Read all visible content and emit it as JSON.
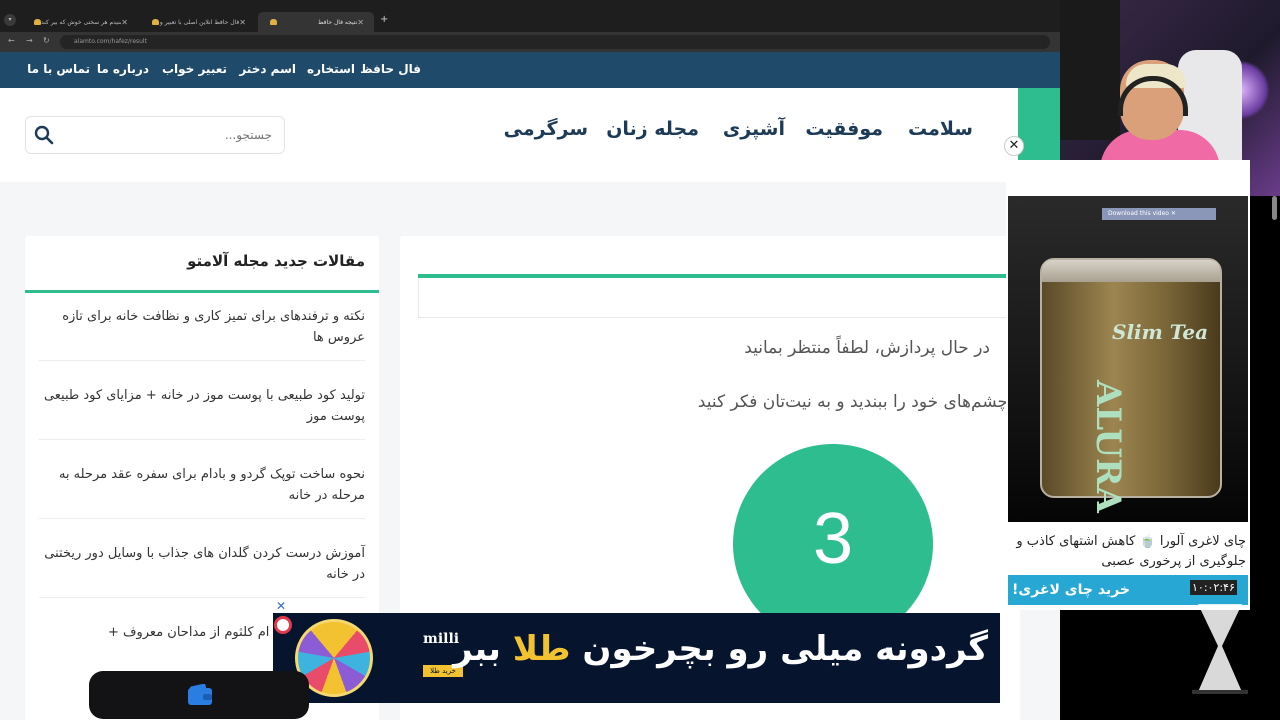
{
  "browser": {
    "tabs": [
      {
        "title": "شنیدم هر سختی خوش که بیر کند"
      },
      {
        "title": "فال حافظ آنلاین اصلی با تعبیر و"
      },
      {
        "title": "نتیجه فال حافظ"
      }
    ],
    "url": "alamto.com/hafez/result"
  },
  "site_nav": {
    "items": [
      "فال حافظ",
      "استخاره",
      "اسم دختر",
      "تعبیر خواب",
      "درباره ما",
      "تماس با ما"
    ]
  },
  "main_menu": {
    "items": [
      "سلامت",
      "موفقیت",
      "آشپزی",
      "مجله زنان",
      "سرگرمی"
    ]
  },
  "search": {
    "placeholder": "جستجو..."
  },
  "sidebar": {
    "title": "مقالات جدید مجله آلامتو",
    "articles": [
      "نکته و ترفندهای برای تمیز کاری و نظافت خانه برای تازه عروس ها",
      "تولید کود طبیعی با پوست موز در خانه + مزایای کود طبیعی پوست موز",
      "نحوه ساخت توپک گردو و بادام برای سفره عقد مرحله به مرحله در خانه",
      "آموزش درست کردن گلدان های جذاب با وسایل دور ریختنی در خانه",
      "زندگینامه حضرت ام کلثوم از مداحان معروف +"
    ]
  },
  "main": {
    "processing": "در حال پردازش، لطفاً منتظر بمانید",
    "instruction": "چشم‌های خود را ببندید و به نیت‌تان فکر کنید",
    "counter": "3"
  },
  "side_ad": {
    "download_label": "Download this video",
    "jar_label": "Slim Tea",
    "jar_brand": "ALURA",
    "text": "چای لاغری آلورا 🍵 کاهش اشتهای کاذب و جلوگیری از پرخوری عصبی",
    "cta": "خرید چای لاغری!",
    "timer": "۱۰:۰۲:۴۶"
  },
  "bottom_ad": {
    "brand": "milli",
    "brand_sub": "خرید طلا",
    "headline_pre": "گردونه میلی رو بچرخون",
    "headline_gold": "طلا",
    "headline_post": "ببر"
  },
  "colors": {
    "accent_green": "#2ebd8f",
    "nav_blue": "#1f4a6a",
    "ad_blue": "#27a8d4"
  }
}
